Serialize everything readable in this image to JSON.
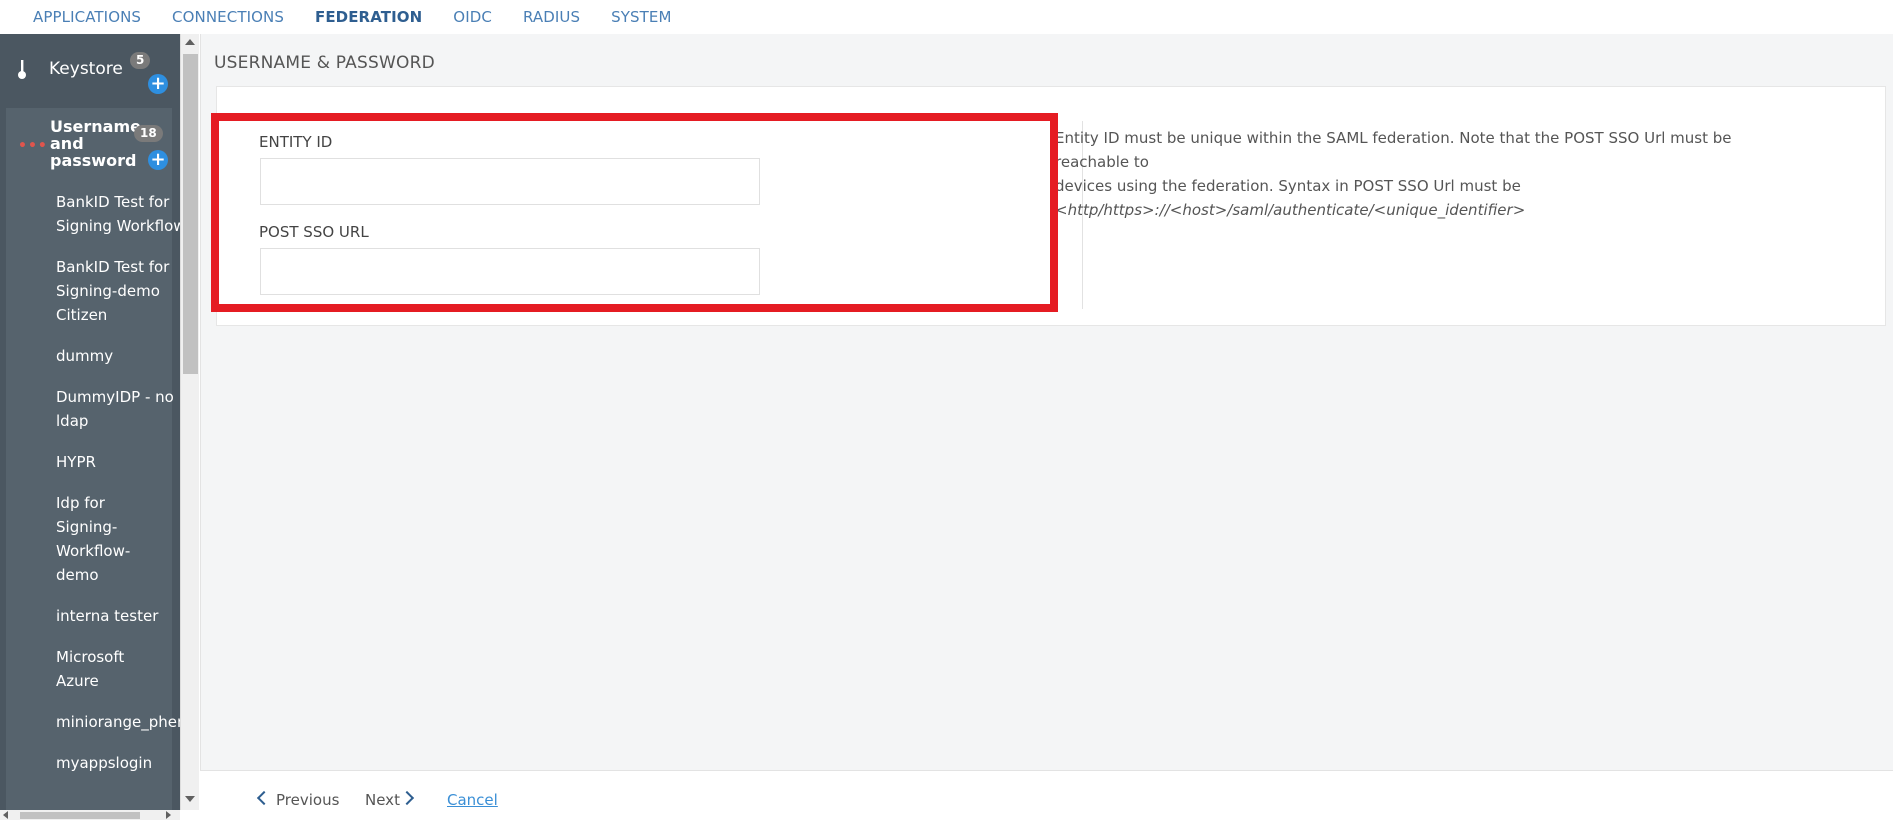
{
  "nav": {
    "tabs": [
      {
        "label": "APPLICATIONS",
        "active": false
      },
      {
        "label": "CONNECTIONS",
        "active": false
      },
      {
        "label": "FEDERATION",
        "active": true
      },
      {
        "label": "OIDC",
        "active": false
      },
      {
        "label": "RADIUS",
        "active": false
      },
      {
        "label": "SYSTEM",
        "active": false
      }
    ]
  },
  "sidebar": {
    "keystore": {
      "label": "Keystore",
      "count": "5",
      "icon": "pin-icon",
      "add_icon": "plus-circle-icon"
    },
    "group": {
      "title": "Username and password",
      "count": "18",
      "icon": "dots-icon",
      "items": [
        "BankID Test for Signing Workflow",
        "BankID Test for Signing-demo Citizen",
        "dummy",
        "DummyIDP - no ldap",
        "HYPR",
        "Idp for Signing-Workflow-demo",
        "interna tester",
        "Microsoft Azure",
        "miniorange_phen",
        "myappslogin"
      ]
    }
  },
  "main": {
    "title": "USERNAME & PASSWORD",
    "fields": {
      "entity_id_label": "ENTITY ID",
      "entity_id_value": "",
      "post_sso_label": "POST SSO URL",
      "post_sso_value": ""
    },
    "help": {
      "line1": "Entity ID must be unique within the SAML federation. Note that the POST SSO Url must be reachable to",
      "line2": "devices using the federation. Syntax in POST SSO Url must be",
      "syntax": "<http/https>://<host>/saml/authenticate/<unique_identifier>"
    }
  },
  "footer": {
    "previous": "Previous",
    "next": "Next",
    "cancel": "Cancel"
  },
  "colors": {
    "accent": "#2e5e90",
    "link": "#3a8fd6",
    "highlight": "#e51c23",
    "sidebar": "#4b5761"
  }
}
